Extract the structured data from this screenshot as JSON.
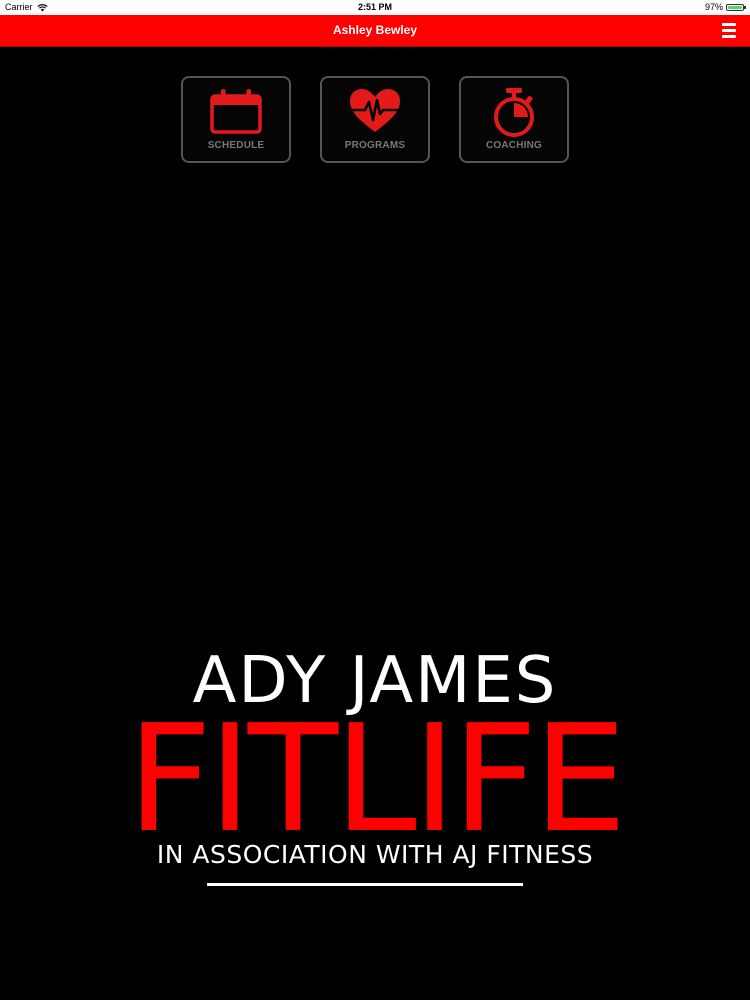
{
  "status_bar": {
    "carrier": "Carrier",
    "time": "2:51 PM",
    "battery_percent": "97%",
    "battery_level": 0.97
  },
  "header": {
    "title": "Ashley Bewley",
    "menu_icon": "hamburger-menu-icon",
    "background_color": "#ff0000"
  },
  "tiles": [
    {
      "label": "SCHEDULE",
      "icon": "calendar-icon"
    },
    {
      "label": "PROGRAMS",
      "icon": "heart-pulse-icon"
    },
    {
      "label": "COACHING",
      "icon": "stopwatch-icon"
    }
  ],
  "logo": {
    "line1": "ADY JAMES",
    "line2": "FITLIFE",
    "line3": "IN ASSOCIATION WITH AJ FITNESS"
  },
  "colors": {
    "accent": "#ff0000",
    "background": "#000000",
    "tile_border": "#555555",
    "tile_label": "#777777"
  }
}
